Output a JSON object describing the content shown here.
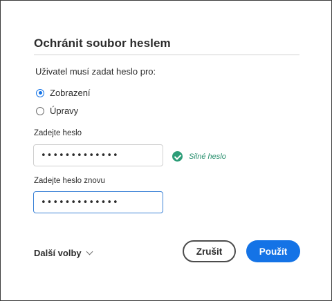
{
  "dialog": {
    "title": "Ochránit soubor heslem",
    "prompt": "Uživatel musí zadat heslo pro:",
    "options": [
      {
        "label": "Zobrazení",
        "checked": true
      },
      {
        "label": "Úpravy",
        "checked": false
      }
    ],
    "password": {
      "label": "Zadejte heslo",
      "value": "•••••••••••••",
      "strength_text": "Silné heslo",
      "strength_color": "#2d9d78"
    },
    "password_repeat": {
      "label": "Zadejte heslo znovu",
      "value": "•••••••••••••"
    },
    "more_options_label": "Další volby",
    "cancel_label": "Zrušit",
    "apply_label": "Použít"
  },
  "colors": {
    "accent": "#1473e6",
    "success": "#2d9d78",
    "text": "#2c2c2c"
  }
}
